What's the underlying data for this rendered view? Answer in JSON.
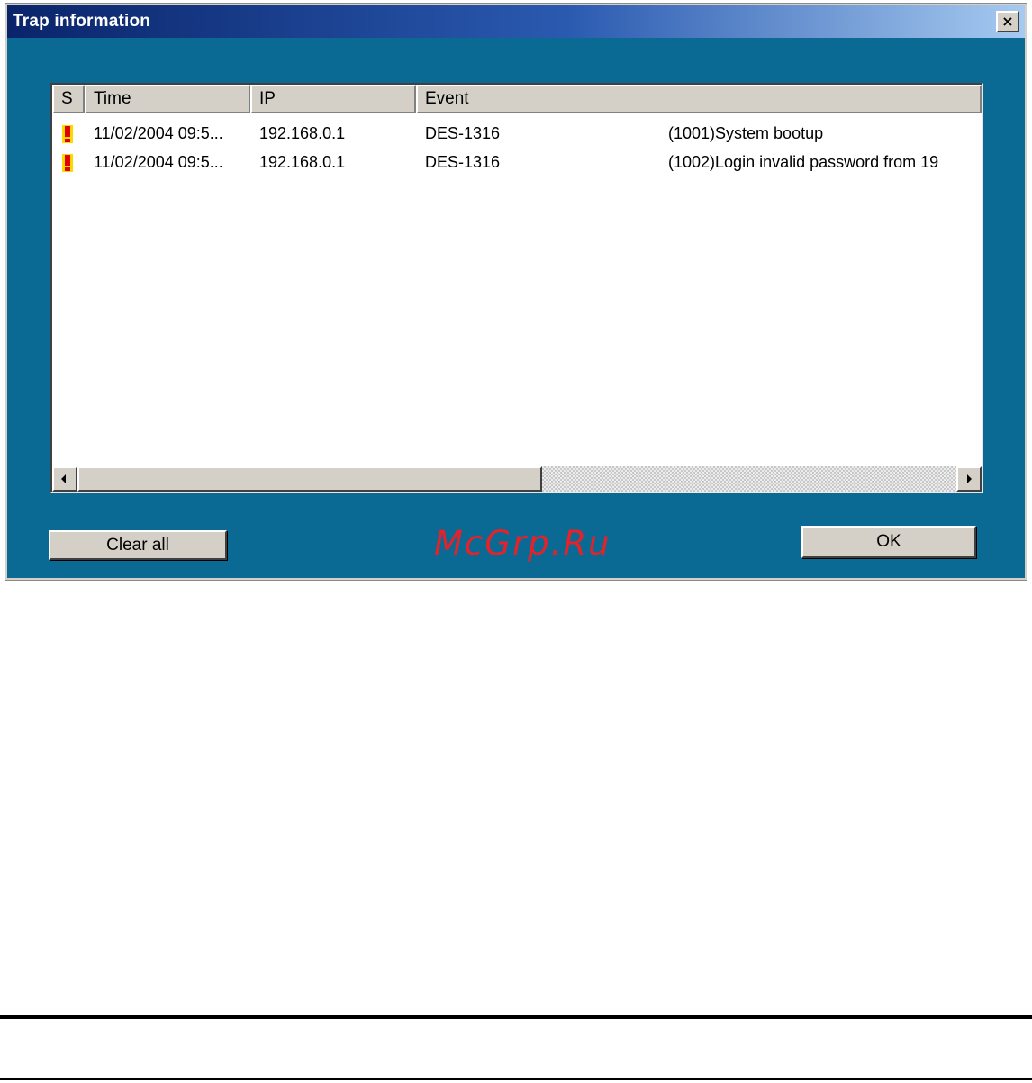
{
  "window": {
    "title": "Trap information",
    "close_label": "×"
  },
  "table": {
    "columns": [
      {
        "label": "S"
      },
      {
        "label": "Time"
      },
      {
        "label": "IP"
      },
      {
        "label": "Event"
      }
    ],
    "rows": [
      {
        "severity_icon": "exclamation-icon",
        "time": "11/02/2004 09:5...",
        "ip": "192.168.0.1",
        "device": "DES-1316",
        "event": "(1001)System bootup"
      },
      {
        "severity_icon": "exclamation-icon",
        "time": "11/02/2004 09:5...",
        "ip": "192.168.0.1",
        "device": "DES-1316",
        "event": "(1002)Login invalid password from 19"
      }
    ]
  },
  "buttons": {
    "clear_all": "Clear all",
    "ok": "OK"
  },
  "watermark": "McGrp.Ru",
  "colors": {
    "dialog_background": "#0a6a94",
    "titlebar_start": "#0a246a",
    "titlebar_end": "#a6caf0",
    "alert_red": "#e00000",
    "alert_yellow": "#ffd800",
    "watermark_red": "#e4222a"
  }
}
